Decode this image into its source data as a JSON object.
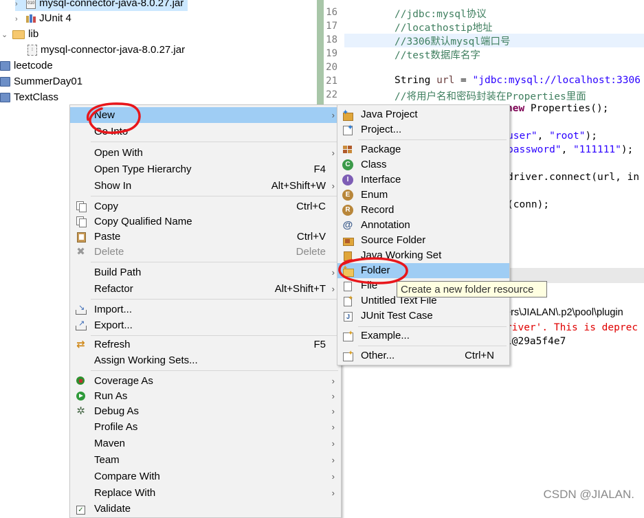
{
  "tree": {
    "items": [
      {
        "label": "mysql-connector-java-8.0.27.jar",
        "twisty": "›"
      },
      {
        "label": "JUnit 4",
        "twisty": "›"
      },
      {
        "label": "lib",
        "twisty": "⌄"
      },
      {
        "label": "mysql-connector-java-8.0.27.jar",
        "twisty": ""
      },
      {
        "label": "leetcode",
        "twisty": ""
      },
      {
        "label": "SummerDay01",
        "twisty": ""
      },
      {
        "label": "TextClass",
        "twisty": ""
      }
    ]
  },
  "editor": {
    "line_numbers": [
      "16",
      "17",
      "18",
      "19",
      "20",
      "21",
      "22"
    ],
    "lines": [
      {
        "comment": "//jdbc:mysql协议"
      },
      {
        "comment": "//locathostip地址"
      },
      {
        "comment": "//3306默认mysql端口号"
      },
      {
        "comment": "//test数据库名字"
      },
      {
        "comment": ""
      },
      {
        "prefix": "String ",
        "var": "url",
        "mid": " = ",
        "str": "\"jdbc:mysql://localhost:3306"
      },
      {
        "comment": "//将用户名和密码封装在Properties里面"
      }
    ],
    "fragments": {
      "new_kw": "new",
      "new_rest": " Properties();",
      "user_pre": "user\"",
      "user_mid": ", ",
      "user_val": "\"root\"",
      "user_end": ");",
      "pass_pre": "password\"",
      "pass_mid": ", ",
      "pass_val": "\"111111\"",
      "pass_end": ");",
      "connect": "driver.connect(url, in",
      "conn": "(conn);"
    }
  },
  "console": {
    "path": "ers\\JIALAN\\.p2\\pool\\plugin",
    "warning": "river'. This is deprec",
    "object": "l@29a5f4e7"
  },
  "context_menu": {
    "items": [
      {
        "label": "New",
        "shortcut": "",
        "submenu": true
      },
      {
        "label": "Go Into",
        "shortcut": "",
        "submenu": false
      },
      {
        "label": "Open With",
        "shortcut": "",
        "submenu": true
      },
      {
        "label": "Open Type Hierarchy",
        "shortcut": "F4",
        "submenu": false
      },
      {
        "label": "Show In",
        "shortcut": "Alt+Shift+W",
        "submenu": true
      },
      {
        "label": "Copy",
        "shortcut": "Ctrl+C",
        "submenu": false
      },
      {
        "label": "Copy Qualified Name",
        "shortcut": "",
        "submenu": false
      },
      {
        "label": "Paste",
        "shortcut": "Ctrl+V",
        "submenu": false
      },
      {
        "label": "Delete",
        "shortcut": "Delete",
        "submenu": false
      },
      {
        "label": "Build Path",
        "shortcut": "",
        "submenu": true
      },
      {
        "label": "Refactor",
        "shortcut": "Alt+Shift+T",
        "submenu": true
      },
      {
        "label": "Import...",
        "shortcut": "",
        "submenu": false
      },
      {
        "label": "Export...",
        "shortcut": "",
        "submenu": false
      },
      {
        "label": "Refresh",
        "shortcut": "F5",
        "submenu": false
      },
      {
        "label": "Assign Working Sets...",
        "shortcut": "",
        "submenu": false
      },
      {
        "label": "Coverage As",
        "shortcut": "",
        "submenu": true
      },
      {
        "label": "Run As",
        "shortcut": "",
        "submenu": true
      },
      {
        "label": "Debug As",
        "shortcut": "",
        "submenu": true
      },
      {
        "label": "Profile As",
        "shortcut": "",
        "submenu": true
      },
      {
        "label": "Maven",
        "shortcut": "",
        "submenu": true
      },
      {
        "label": "Team",
        "shortcut": "",
        "submenu": true
      },
      {
        "label": "Compare With",
        "shortcut": "",
        "submenu": true
      },
      {
        "label": "Replace With",
        "shortcut": "",
        "submenu": true
      },
      {
        "label": "Validate",
        "shortcut": "",
        "submenu": false
      }
    ],
    "arrow_glyph": "›"
  },
  "new_submenu": {
    "items": [
      {
        "label": "Java Project",
        "shortcut": ""
      },
      {
        "label": "Project...",
        "shortcut": ""
      },
      {
        "label": "Package",
        "shortcut": ""
      },
      {
        "label": "Class",
        "shortcut": ""
      },
      {
        "label": "Interface",
        "shortcut": ""
      },
      {
        "label": "Enum",
        "shortcut": ""
      },
      {
        "label": "Record",
        "shortcut": ""
      },
      {
        "label": "Annotation",
        "shortcut": ""
      },
      {
        "label": "Source Folder",
        "shortcut": ""
      },
      {
        "label": "Java Working Set",
        "shortcut": ""
      },
      {
        "label": "Folder",
        "shortcut": ""
      },
      {
        "label": "File",
        "shortcut": ""
      },
      {
        "label": "Untitled Text File",
        "shortcut": ""
      },
      {
        "label": "JUnit Test Case",
        "shortcut": ""
      },
      {
        "label": "Example...",
        "shortcut": ""
      },
      {
        "label": "Other...",
        "shortcut": "Ctrl+N"
      }
    ]
  },
  "tooltip": {
    "text": "Create a new folder resource"
  },
  "watermark": {
    "text": "CSDN @JIALAN."
  },
  "colors": {
    "menu_highlight": "#9fcdf4",
    "annotation_red": "#e8161b",
    "comment_green": "#3f7f5f",
    "string_blue": "#2a00ff"
  }
}
